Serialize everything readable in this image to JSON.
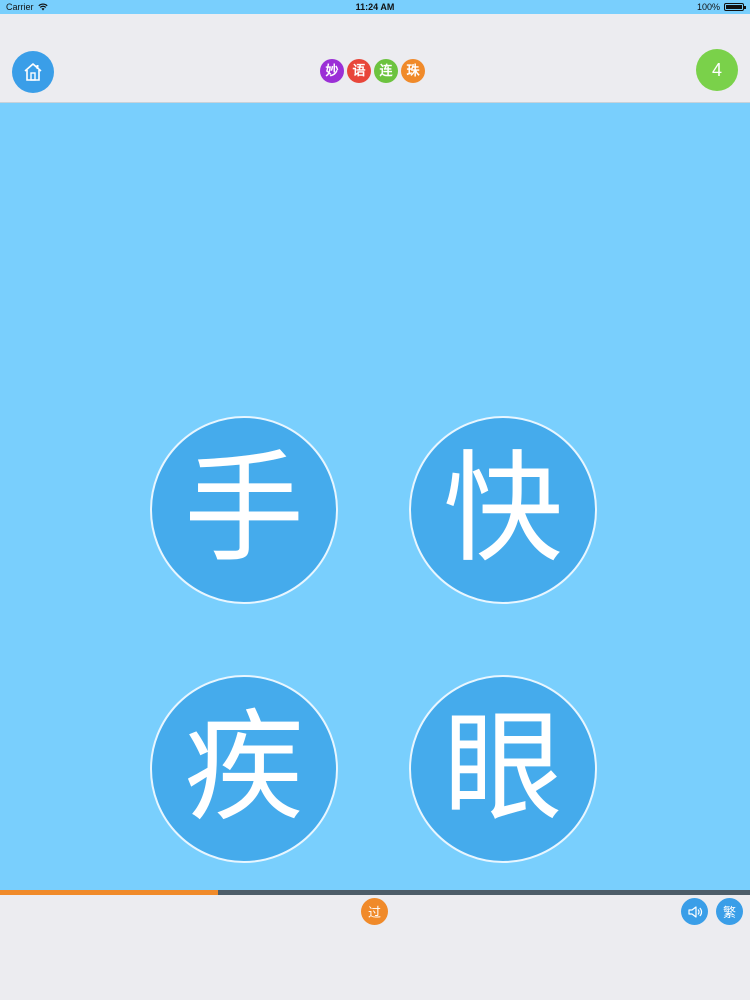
{
  "status_bar": {
    "carrier": "Carrier",
    "time": "11:24 AM",
    "battery": "100%",
    "battery_level": 1.0
  },
  "header": {
    "logo_chars": [
      {
        "char": "妙",
        "color": "#9b2fd6"
      },
      {
        "char": "语",
        "color": "#e8463a"
      },
      {
        "char": "连",
        "color": "#6cc33f"
      },
      {
        "char": "珠",
        "color": "#f08a2a"
      }
    ],
    "level": "4",
    "icons": {
      "home": "home-icon"
    }
  },
  "board": {
    "tiles": [
      "手",
      "快",
      "疾",
      "眼"
    ]
  },
  "progress": {
    "fraction": 0.29,
    "fill_color": "#f08a2a",
    "track_color": "#4d5d69"
  },
  "footer": {
    "skip_label": "过",
    "traditional_label": "繁",
    "icons": {
      "sound": "speaker-icon"
    }
  },
  "colors": {
    "background": "#79cffd",
    "tile": "#45abec",
    "button_blue": "#3a9ee8",
    "level_green": "#7ad14a",
    "accent_orange": "#f08a2a"
  }
}
